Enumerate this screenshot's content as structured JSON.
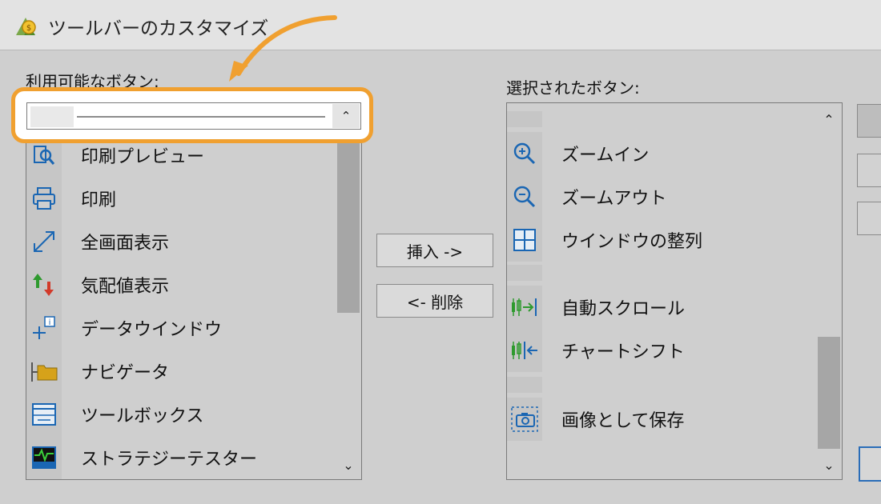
{
  "window": {
    "title": "ツールバーのカスタマイズ",
    "icon": "metatrader-app-icon"
  },
  "available": {
    "label": "利用可能なボタン:",
    "items": [
      {
        "label": "印刷プレビュー",
        "icon": "print-preview-icon"
      },
      {
        "label": "印刷",
        "icon": "printer-icon"
      },
      {
        "label": "全画面表示",
        "icon": "fullscreen-arrow-icon"
      },
      {
        "label": "気配値表示",
        "icon": "market-watch-arrows-icon"
      },
      {
        "label": "データウインドウ",
        "icon": "data-window-icon"
      },
      {
        "label": "ナビゲータ",
        "icon": "navigator-folder-icon"
      },
      {
        "label": "ツールボックス",
        "icon": "toolbox-icon"
      },
      {
        "label": "ストラテジーテスター",
        "icon": "strategy-tester-icon"
      }
    ]
  },
  "selected": {
    "label": "選択されたボタン:",
    "items": [
      {
        "label": "ズームイン",
        "icon": "zoom-in-icon"
      },
      {
        "label": "ズームアウト",
        "icon": "zoom-out-icon"
      },
      {
        "label": "ウインドウの整列",
        "icon": "tile-windows-icon"
      },
      {
        "label": "自動スクロール",
        "icon": "auto-scroll-icon"
      },
      {
        "label": "チャートシフト",
        "icon": "chart-shift-icon"
      },
      {
        "label": "画像として保存",
        "icon": "screenshot-camera-icon"
      }
    ]
  },
  "buttons": {
    "insert": "挿入 ->",
    "remove": "<- 削除"
  },
  "colors": {
    "highlight": "#f0a030",
    "accent_blue": "#1a66b3",
    "scroll_thumb": "#a6a6a6"
  }
}
